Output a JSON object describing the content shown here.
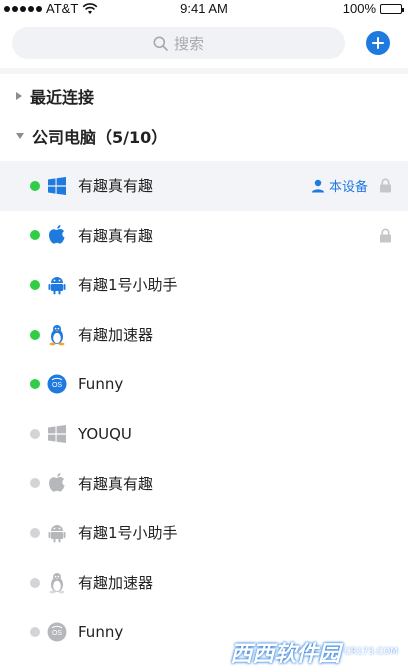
{
  "status_bar": {
    "carrier": "AT&T",
    "time": "9:41 AM",
    "battery": "100%"
  },
  "search": {
    "placeholder": "搜索",
    "icon": "search-icon"
  },
  "add_button": {
    "icon": "plus-icon"
  },
  "groups": {
    "recent": {
      "label": "最近连接",
      "expanded": false
    },
    "company": {
      "label": "公司电脑（5/10）",
      "expanded": true
    }
  },
  "devices": [
    {
      "name": "有趣真有趣",
      "os": "windows",
      "online": true,
      "this_device": "本设备",
      "locked": true
    },
    {
      "name": "有趣真有趣",
      "os": "apple",
      "online": true,
      "locked": true
    },
    {
      "name": "有趣1号小助手",
      "os": "android",
      "online": true,
      "locked": false
    },
    {
      "name": "有趣加速器",
      "os": "linux",
      "online": true,
      "locked": false
    },
    {
      "name": "Funny",
      "os": "chrome-os",
      "online": true,
      "locked": false
    },
    {
      "name": "YOUQU",
      "os": "windows",
      "online": false,
      "locked": false
    },
    {
      "name": "有趣真有趣",
      "os": "apple",
      "online": false,
      "locked": false
    },
    {
      "name": "有趣1号小助手",
      "os": "android",
      "online": false,
      "locked": false
    },
    {
      "name": "有趣加速器",
      "os": "linux",
      "online": false,
      "locked": false
    },
    {
      "name": "Funny",
      "os": "chrome-os",
      "online": false,
      "locked": false
    }
  ],
  "watermark": {
    "brand": "西西软件园",
    "domain": "CR173.COM"
  },
  "colors": {
    "accent": "#1f7ae0",
    "online": "#32cd46",
    "offline": "#d2d4d8",
    "current_row_bg": "#f3f4f7"
  }
}
